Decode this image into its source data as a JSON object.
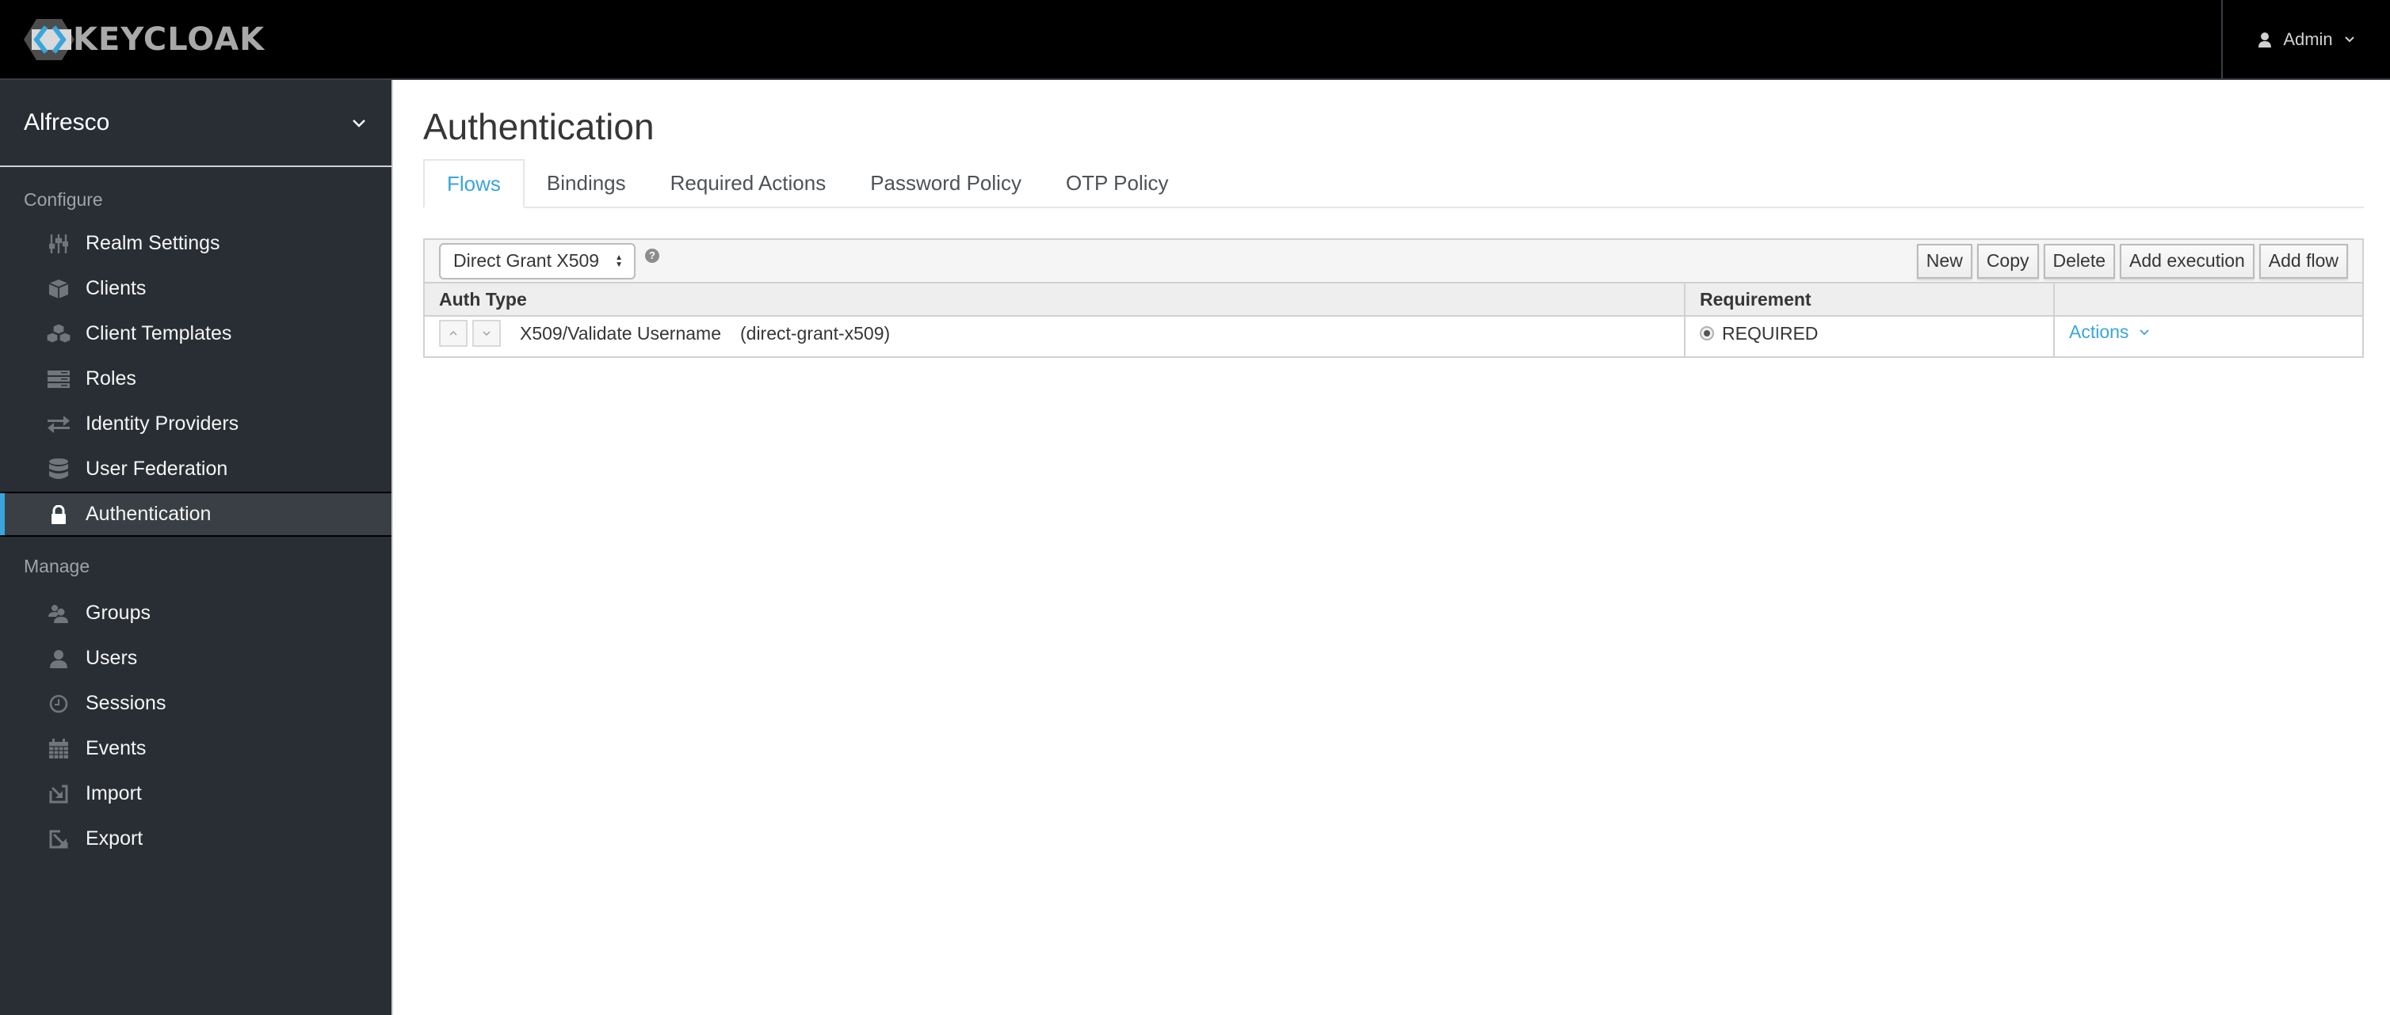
{
  "header": {
    "brand": "KEYCLOAK",
    "user_menu": {
      "label": "Admin",
      "icon": "user-icon",
      "caret": "chevron-down-icon"
    }
  },
  "sidebar": {
    "realm": {
      "name": "Alfresco",
      "icon": "chevron-down-icon"
    },
    "sections": [
      {
        "label": "Configure",
        "items": [
          {
            "label": "Realm Settings",
            "icon": "sliders-icon",
            "active": false
          },
          {
            "label": "Clients",
            "icon": "cube-icon",
            "active": false
          },
          {
            "label": "Client Templates",
            "icon": "cubes-icon",
            "active": false
          },
          {
            "label": "Roles",
            "icon": "server-stack-icon",
            "active": false
          },
          {
            "label": "Identity Providers",
            "icon": "exchange-icon",
            "active": false
          },
          {
            "label": "User Federation",
            "icon": "database-icon",
            "active": false
          },
          {
            "label": "Authentication",
            "icon": "lock-icon",
            "active": true
          }
        ]
      },
      {
        "label": "Manage",
        "items": [
          {
            "label": "Groups",
            "icon": "users-icon",
            "active": false
          },
          {
            "label": "Users",
            "icon": "user-icon",
            "active": false
          },
          {
            "label": "Sessions",
            "icon": "clock-icon",
            "active": false
          },
          {
            "label": "Events",
            "icon": "calendar-icon",
            "active": false
          },
          {
            "label": "Import",
            "icon": "import-icon",
            "active": false
          },
          {
            "label": "Export",
            "icon": "export-icon",
            "active": false
          }
        ]
      }
    ]
  },
  "main": {
    "title": "Authentication",
    "tabs": [
      {
        "label": "Flows",
        "active": true
      },
      {
        "label": "Bindings",
        "active": false
      },
      {
        "label": "Required Actions",
        "active": false
      },
      {
        "label": "Password Policy",
        "active": false
      },
      {
        "label": "OTP Policy",
        "active": false
      }
    ],
    "flow_select": {
      "value": "Direct Grant X509",
      "help_icon": "question-circle-icon"
    },
    "toolbar_buttons": [
      "New",
      "Copy",
      "Delete",
      "Add execution",
      "Add flow"
    ],
    "table": {
      "columns": [
        "Auth Type",
        "Requirement",
        ""
      ],
      "rows": [
        {
          "name": "X509/Validate Username",
          "provider": "(direct-grant-x509)",
          "requirement": "REQUIRED",
          "actions_label": "Actions"
        }
      ]
    }
  },
  "colors": {
    "header_bg": "#000000",
    "sidebar_bg": "#292e34",
    "accent": "#39a5dc",
    "active_item_bg": "#393f44"
  }
}
